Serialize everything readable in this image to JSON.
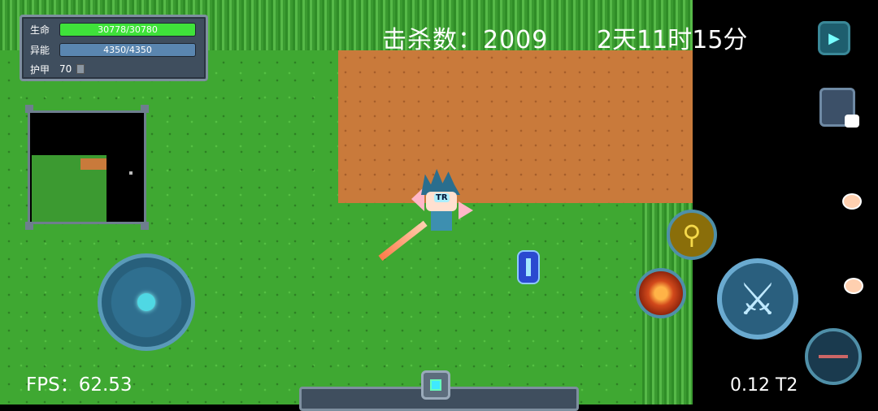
{
  "hud": {
    "hp_label": "生命",
    "hp_text": "30778/30780",
    "hp_fraction": 0.9999,
    "mp_label": "异能",
    "mp_text": "4350/4350",
    "mp_fraction": 1.0,
    "armor_label": "护甲",
    "armor_value": "70"
  },
  "kills": "击杀数：2009",
  "time": "2天11时15分",
  "fps": "FPS：62.53",
  "version": "0.12 T2",
  "hero_tag": "TR",
  "colors": {
    "grass": "#3fa832",
    "dirt": "#c97a3b",
    "hp": "#3fe23a",
    "mp": "#5a86b0"
  },
  "icons": {
    "play": "play-icon",
    "bag": "backpack-icon",
    "skill_yellow": "body-buff-icon",
    "skill_fire": "fire-orb-icon",
    "attack": "crossed-swords-icon",
    "weapon": "weapon-swap-icon",
    "pet": "pet-icon"
  }
}
